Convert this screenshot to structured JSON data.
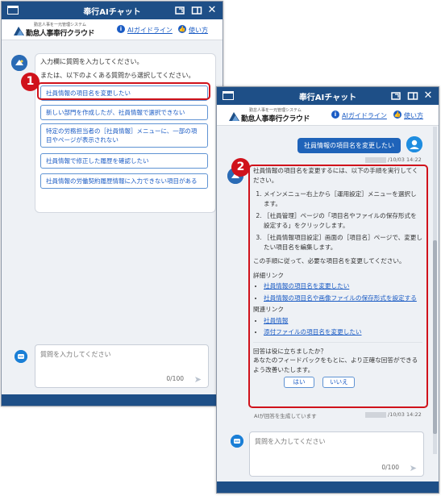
{
  "window1": {
    "title": "奉行AIチャット",
    "logo_sub": "勤怠人事を一元管理システム",
    "logo_main": "勤怠人事奉行クラウド",
    "guide_link": "AIガイドライン",
    "howto_link": "使い方",
    "prompt_line1": "入力欄に質問を入力してください。",
    "prompt_line2": "または、以下のよくある質問から選択してください。",
    "questions": [
      "社員情報の項目名を変更したい",
      "新しい部門を作成したが、社員情報で選択できない",
      "特定の労務担当者の［社員情報］メニューに、一部の項目やページが表示されない",
      "社員情報で修正した履歴を確認したい",
      "社員情報の労働契約履歴情報に入力できない項目がある"
    ],
    "input_placeholder": "質問を入力してください",
    "counter": "0/100",
    "badge": "1"
  },
  "window2": {
    "title": "奉行AIチャット",
    "logo_sub": "勤怠人事を一元管理システム",
    "logo_main": "勤怠人事奉行クラウド",
    "guide_link": "AIガイドライン",
    "howto_link": "使い方",
    "user_message": "社員情報の項目名を変更したい",
    "user_timestamp": "/10/03 14:22",
    "answer_intro": "社員情報の項目名を変更するには、以下の手順を実行してください。",
    "steps": [
      "メインメニュー右上から［運用設定］メニューを選択します。",
      "［社員管理］ページの「項目名やファイルの保存形式を設定する」をクリックします。",
      "［社員情報項目設定］画面の［項目名］ページで、変更したい項目名を編集します。"
    ],
    "answer_outro": "この手順に従って、必要な項目名を変更してください。",
    "detail_heading": "詳細リンク",
    "detail_links": [
      "社員情報の項目名を変更したい",
      "社員情報の項目名や画像ファイルの保存形式を設定する"
    ],
    "related_heading": "関連リンク",
    "related_links": [
      "社員情報",
      "添付ファイルの項目名を変更したい"
    ],
    "feedback_q": "回答は役に立ちましたか？",
    "feedback_text": "あなたのフィードバックをもとに、より正確な回答ができるよう改善いたします。",
    "yes": "はい",
    "no": "いいえ",
    "ai_note": "AIが回答を生成しています",
    "ai_timestamp": "/10/03 14:22",
    "input_placeholder": "質問を入力してください",
    "counter": "0/100",
    "badge": "2"
  },
  "colors": {
    "titlebar": "#1e4f87",
    "accent": "#1a5bc4",
    "highlight": "#d0121b"
  }
}
